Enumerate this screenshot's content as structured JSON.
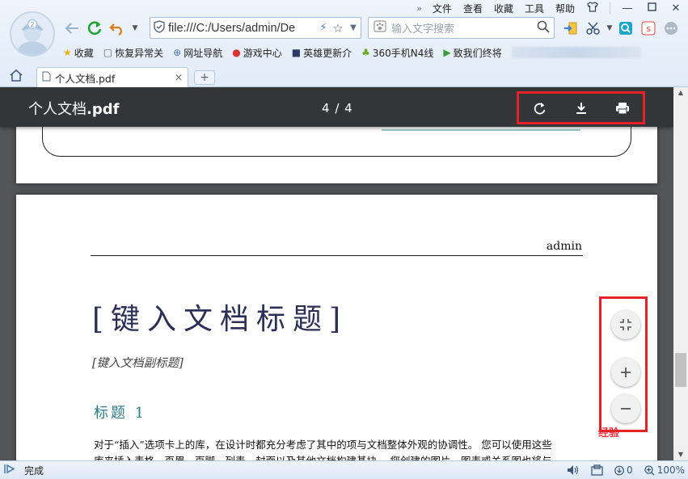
{
  "menu": {
    "items": [
      "文件",
      "查看",
      "收藏",
      "工具",
      "帮助"
    ],
    "chevron": "»"
  },
  "nav": {
    "address": "file:///C:/Users/admin/De",
    "search_placeholder": "输入文字搜索"
  },
  "bookmarks": [
    {
      "label": "收藏",
      "icon": "star-icon",
      "glyph": "★",
      "color": "#f0b400"
    },
    {
      "label": "恢复异常关",
      "icon": "page-icon",
      "glyph": "▢",
      "color": "#5b6b80"
    },
    {
      "label": "网址导航",
      "icon": "globe-icon",
      "glyph": "⊕",
      "color": "#4a77b5"
    },
    {
      "label": "游戏中心",
      "icon": "game-icon",
      "glyph": "●",
      "color": "#d93030"
    },
    {
      "label": "英雄更新介",
      "icon": "hero-icon",
      "glyph": "■",
      "color": "#2b3a67"
    },
    {
      "label": "360手机N4线",
      "icon": "android-icon",
      "glyph": "♣",
      "color": "#6cab2a"
    },
    {
      "label": "致我们终将",
      "icon": "play-icon",
      "glyph": "▶",
      "color": "#3a9a3a"
    }
  ],
  "tab": {
    "title": "个人文档.pdf",
    "close": "×",
    "new": "+"
  },
  "pdf": {
    "title_name": "个人文档",
    "title_ext": ".pdf",
    "current_page": "4",
    "separator": "/",
    "total_pages": "4",
    "author": "admin",
    "doc_title": "[键入文档标题]",
    "doc_subtitle": "[键入文档副标题]",
    "heading": "标题 1",
    "body_line1": "对于“插入”选项卡上的库，在设计时都充分考虑了其中的项与文档整体外观的协调性。 您可以使用这些",
    "body_line2": "库来插入表格、页眉、页脚、列表、封面以及其他文档构建基块。 您创建的图片、图表或关系图也将与"
  },
  "watermark": "经验",
  "status": {
    "text": "完成",
    "downloads": "0",
    "zoom": "100%"
  },
  "colors": {
    "highlight": "#e8202a",
    "pdf_toolbar": "#323639",
    "viewer_bg": "#525659",
    "heading": "#2e7c8a",
    "title": "#2b2f55"
  }
}
